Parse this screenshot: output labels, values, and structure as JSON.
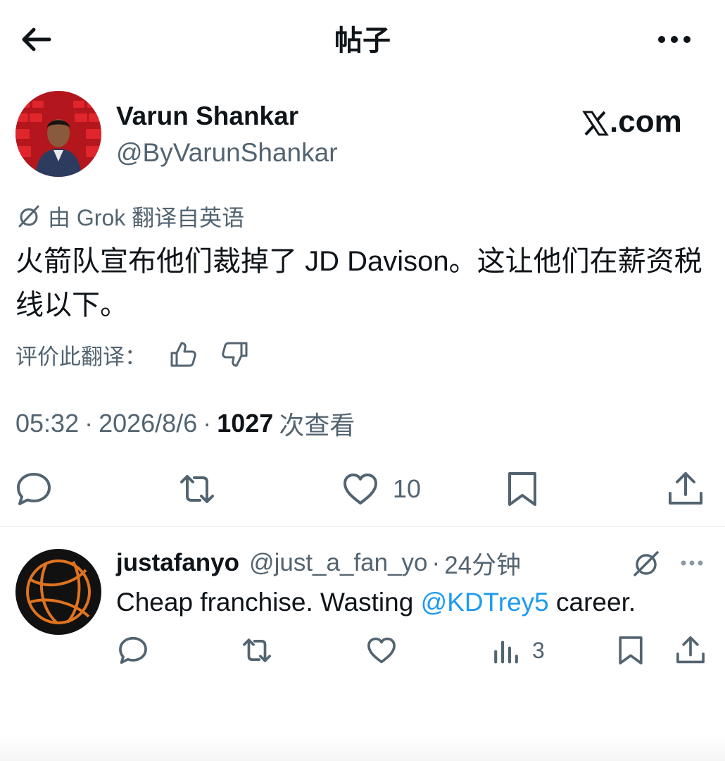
{
  "header": {
    "title": "帖子"
  },
  "post": {
    "author": {
      "name": "Varun Shankar",
      "handle": "@ByVarunShankar"
    },
    "watermark": ".com",
    "translation_label": "由 Grok 翻译自英语",
    "text": "火箭队宣布他们裁掉了 JD Davison。这让他们在薪资税线以下。",
    "rate_label": "评价此翻译：",
    "time": "05:32",
    "date": "2026/8/6",
    "views_count": "1027",
    "views_label": "次查看",
    "meta_separator": "·",
    "likes_count": "10"
  },
  "reply": {
    "name": "justafanyo",
    "handle": "@just_a_fan_yo",
    "separator": "·",
    "time": "24分钟",
    "text_before": "Cheap franchise. Wasting ",
    "mention": "@KDTrey5",
    "text_after": " career.",
    "views_count": "3"
  },
  "colors": {
    "text": "#0f1419",
    "secondary": "#536471",
    "link": "#1d9bf0",
    "divider": "#eff3f4"
  }
}
